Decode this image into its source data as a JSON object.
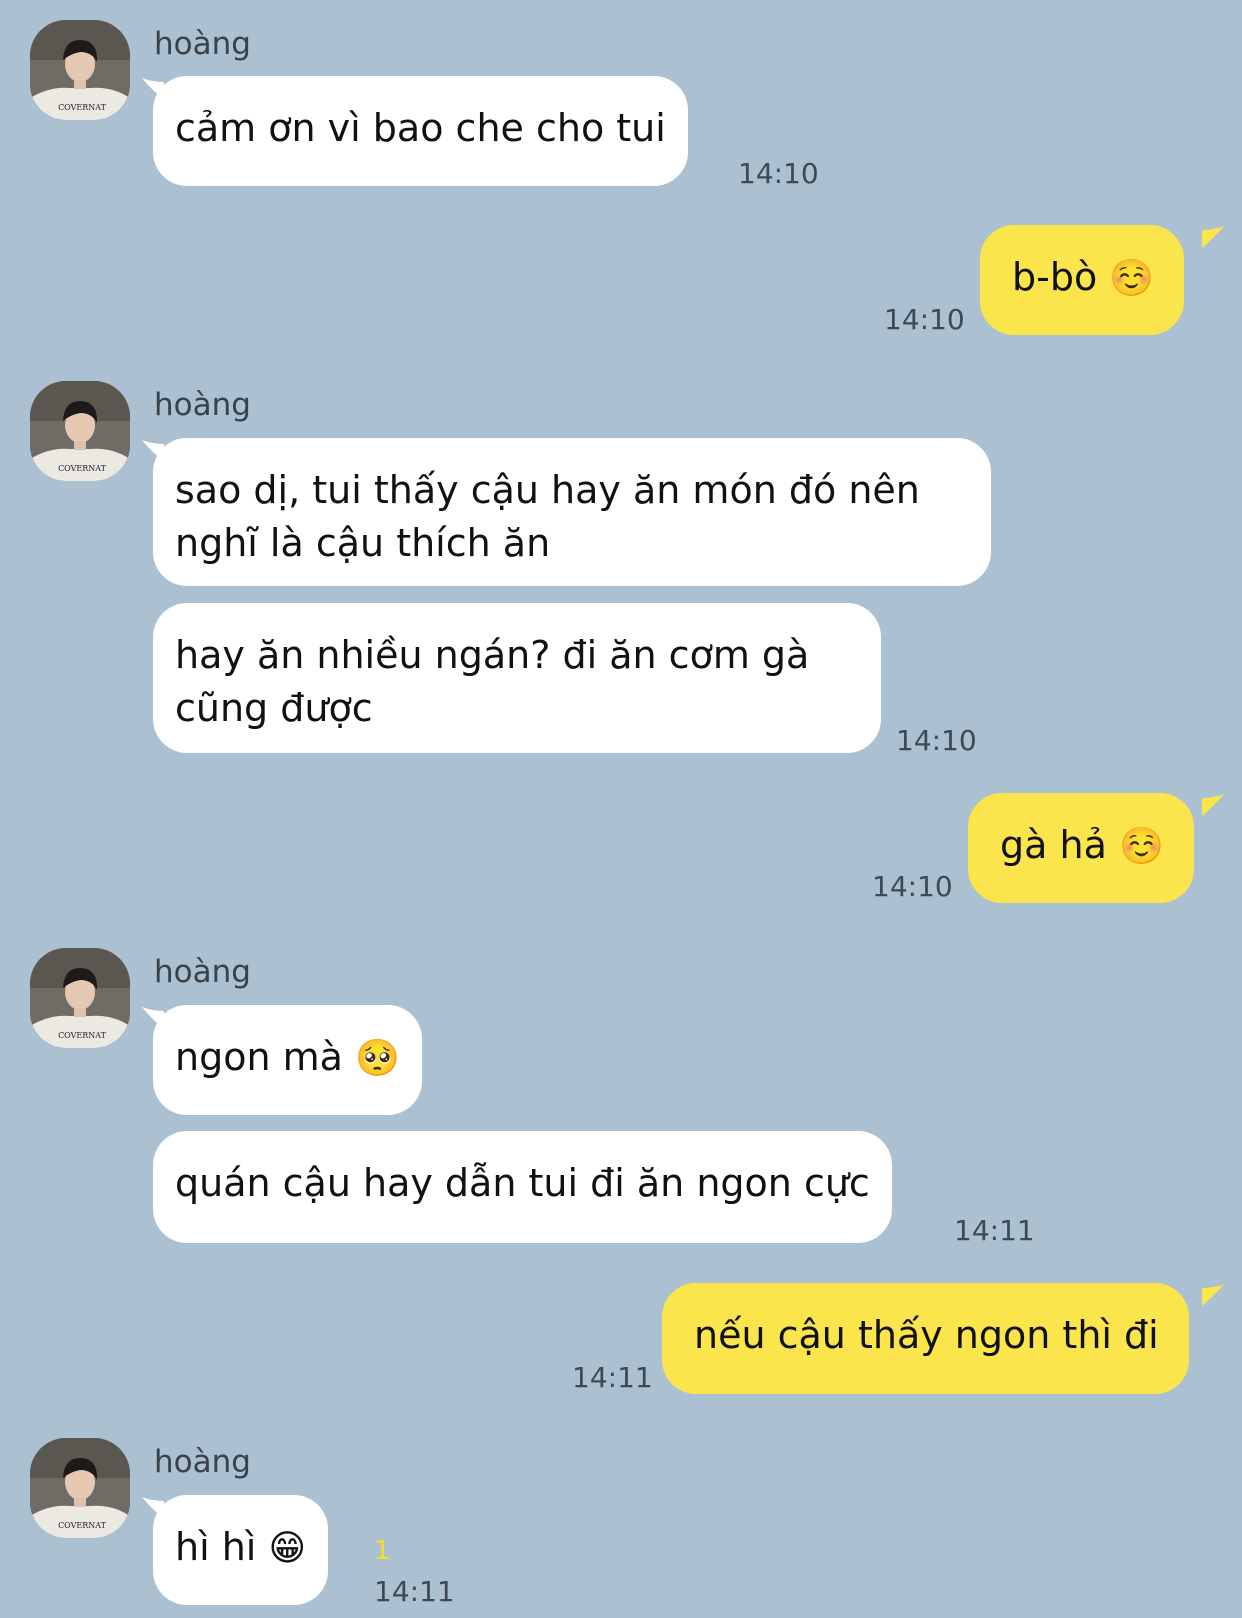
{
  "chat": {
    "contact_name": "hoàng",
    "avatar_shirt_text": "COVERNAT",
    "messages": [
      {
        "side": "in",
        "text": "cảm ơn vì bao che cho tui",
        "time": "14:10"
      },
      {
        "side": "out",
        "text": "b-bò",
        "emoji": "☺️",
        "time": "14:10"
      },
      {
        "side": "in",
        "text": "sao dị, tui thấy cậu hay ăn món đó nên nghĩ là cậu thích ăn"
      },
      {
        "side": "in",
        "text": "hay ăn nhiều ngán? đi ăn cơm gà cũng được",
        "time": "14:10"
      },
      {
        "side": "out",
        "text": "gà hả",
        "emoji": "☺️",
        "time": "14:10"
      },
      {
        "side": "in",
        "text": "ngon mà",
        "emoji": "🥺"
      },
      {
        "side": "in",
        "text": "quán cậu hay dẫn tui đi ăn ngon cực",
        "time": "14:11"
      },
      {
        "side": "out",
        "text": "nếu cậu thấy ngon thì đi",
        "time": "14:11"
      },
      {
        "side": "in",
        "text": "hì hì",
        "emoji": "😁",
        "time": "14:11",
        "unread_count": "1"
      }
    ]
  },
  "colors": {
    "background": "#abc1d1",
    "incoming_bubble": "#ffffff",
    "outgoing_bubble": "#fbe54d",
    "unread": "#f4de2a"
  }
}
